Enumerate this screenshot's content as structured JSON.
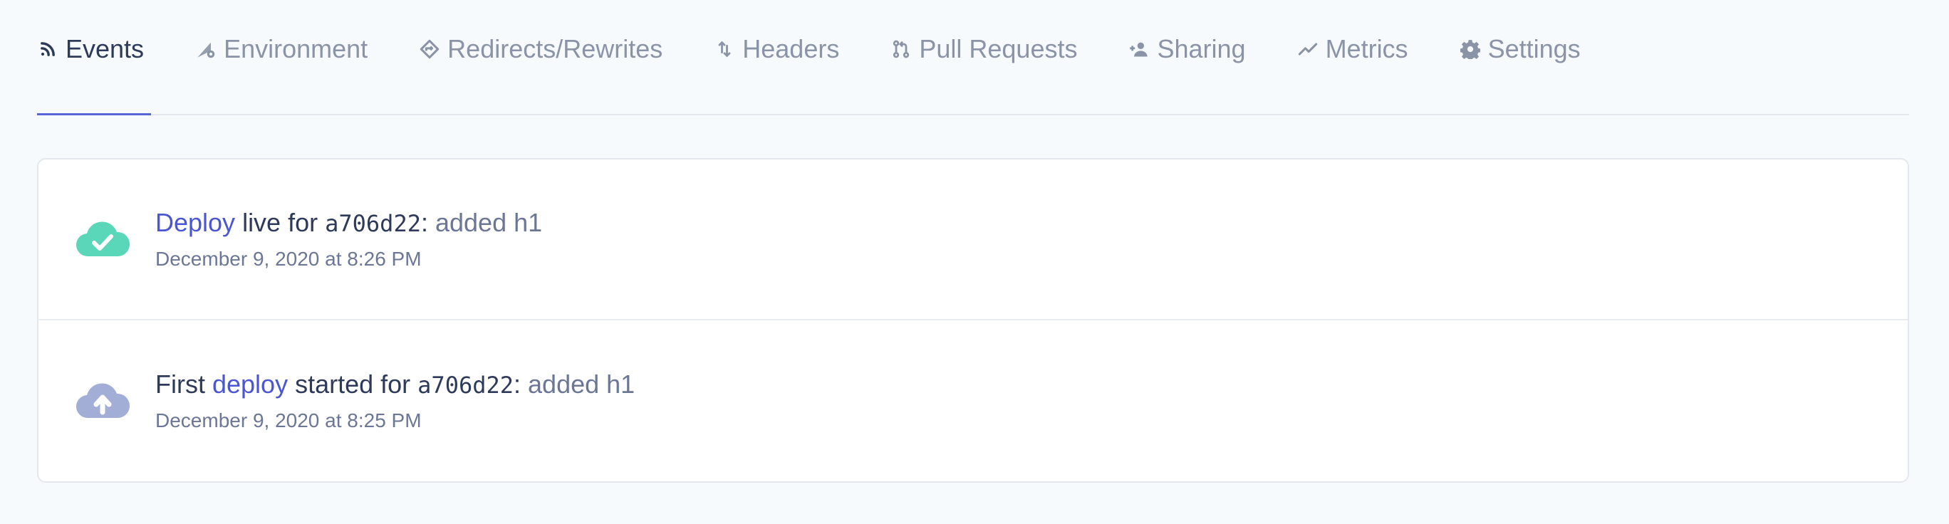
{
  "tabs": [
    {
      "label": "Events",
      "icon": "rss-icon",
      "active": true
    },
    {
      "label": "Environment",
      "icon": "ruler-gear-icon",
      "active": false
    },
    {
      "label": "Redirects/Rewrites",
      "icon": "diamond-arrow-icon",
      "active": false
    },
    {
      "label": "Headers",
      "icon": "arrows-updown-icon",
      "active": false
    },
    {
      "label": "Pull Requests",
      "icon": "git-pull-request-icon",
      "active": false
    },
    {
      "label": "Sharing",
      "icon": "user-plus-icon",
      "active": false
    },
    {
      "label": "Metrics",
      "icon": "line-chart-icon",
      "active": false
    },
    {
      "label": "Settings",
      "icon": "gear-icon",
      "active": false
    }
  ],
  "events": [
    {
      "icon": "cloud-check-icon",
      "prefix": "",
      "link": "Deploy",
      "middle": " live for ",
      "sha": "a706d22",
      "colon": ":",
      "message": " added h1",
      "timestamp": "December 9, 2020 at 8:26 PM"
    },
    {
      "icon": "cloud-upload-icon",
      "prefix": "First ",
      "link": "deploy",
      "middle": " started for ",
      "sha": "a706d22",
      "colon": ":",
      "message": " added h1",
      "timestamp": "December 9, 2020 at 8:25 PM"
    }
  ],
  "colors": {
    "accent": "#5865d6",
    "link": "#4b56d2",
    "success": "#5ad6b8",
    "pending": "#a3aed6"
  }
}
